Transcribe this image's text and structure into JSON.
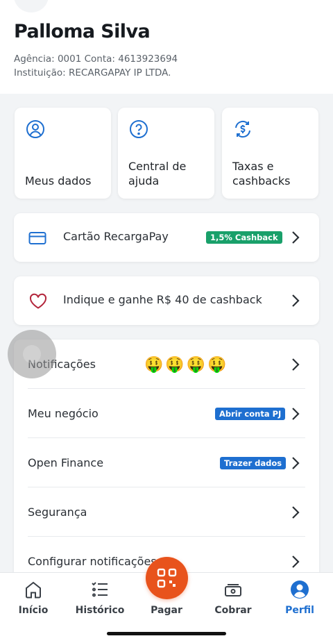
{
  "profile": {
    "name": "Palloma Silva",
    "account_line": "Agência: 0001 Conta: 4613923694",
    "institution_line": "Instituição: RECARGAPAY IP LTDA."
  },
  "quick_actions": [
    {
      "label": "Meus dados",
      "icon": "user-circle-icon"
    },
    {
      "label": "Central de ajuda",
      "icon": "help-circle-icon"
    },
    {
      "label": "Taxas e cashbacks",
      "icon": "dollar-refresh-icon"
    }
  ],
  "card_row": {
    "label": "Cartão RecargaPay",
    "badge": "1,5% Cashback",
    "icon": "credit-card-icon"
  },
  "referral_row": {
    "label": "Indique e ganhe R$ 40 de cashback",
    "icon": "heart-icon"
  },
  "settings_list": [
    {
      "label": "Notificações",
      "emojis": "🤑🤑🤑🤑"
    },
    {
      "label": "Meu negócio",
      "badge": "Abrir conta PJ"
    },
    {
      "label": "Open Finance",
      "badge": "Trazer dados"
    },
    {
      "label": "Segurança"
    },
    {
      "label": "Configurar notificações"
    }
  ],
  "tabbar": {
    "tabs": [
      {
        "label": "Início",
        "icon": "home-icon"
      },
      {
        "label": "Histórico",
        "icon": "list-icon"
      },
      {
        "label": "Pagar",
        "icon": "qr-code-icon"
      },
      {
        "label": "Cobrar",
        "icon": "wallet-icon"
      },
      {
        "label": "Perfil",
        "icon": "profile-icon"
      }
    ],
    "active": "Perfil"
  },
  "colors": {
    "accent": "#1e6fd0",
    "pay_button": "#e8531c",
    "cashback_badge": "#19a06a",
    "heart": "#b3263c"
  }
}
